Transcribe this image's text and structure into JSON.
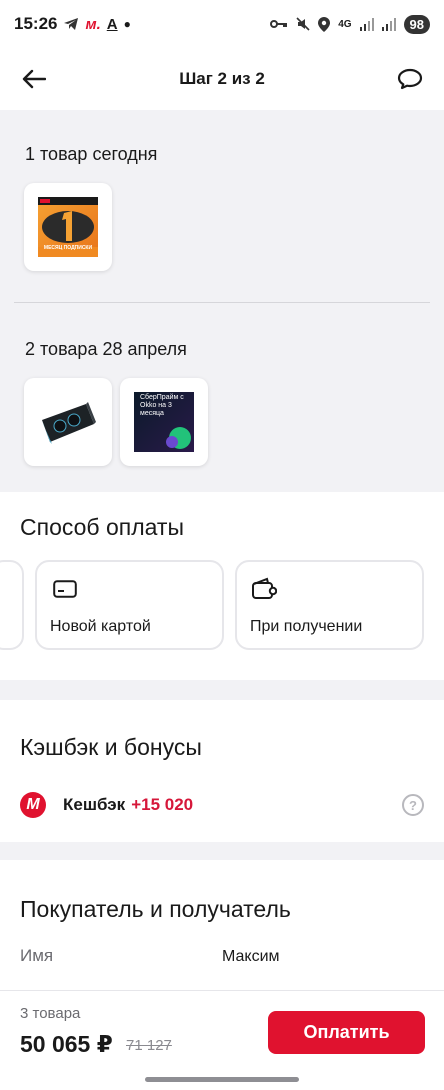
{
  "status_bar": {
    "time": "15:26",
    "operator_icon_text": "м.",
    "a_icon_text": "A",
    "network_type": "4G",
    "battery": "98"
  },
  "header": {
    "title": "Шаг 2 из 2"
  },
  "delivery": {
    "group1_title": "1 товар сегодня",
    "group1_item_text": "МЕСЯЦ ПОДПИСКИ",
    "group2_title": "2 товара 28 апреля",
    "group2_item2_text": "СберПрайм с Okko на 3 месяца"
  },
  "payment": {
    "title": "Способ оплаты",
    "options": [
      {
        "label": "Новой картой",
        "icon": "card-icon"
      },
      {
        "label": "При получении",
        "icon": "wallet-icon"
      }
    ]
  },
  "cashback": {
    "title": "Кэшбэк и бонусы",
    "logo_text": "М",
    "label": "Кешбэк",
    "value": "+15 020",
    "help_text": "?"
  },
  "buyer": {
    "title": "Покупатель и получатель",
    "name_label": "Имя",
    "name_value": "Максим"
  },
  "bottom_bar": {
    "count": "3 товара",
    "price": "50 065 ₽",
    "old_price": "71 127",
    "pay_button": "Оплатить"
  },
  "colors": {
    "accent": "#e0122f",
    "cashback_value": "#d6173a",
    "background": "#f2f2f5"
  }
}
